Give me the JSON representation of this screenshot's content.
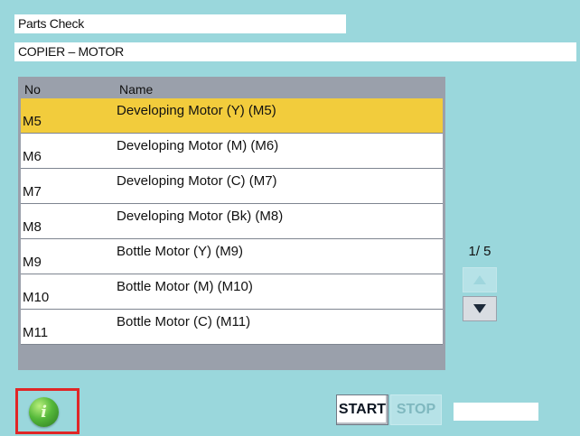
{
  "header": {
    "title": "Parts Check",
    "subtitle": "COPIER – MOTOR"
  },
  "table": {
    "columns": {
      "no": "No",
      "name": "Name"
    },
    "rows": [
      {
        "no": "M5",
        "name": "Developing Motor (Y) (M5)",
        "selected": true
      },
      {
        "no": "M6",
        "name": "Developing Motor (M) (M6)"
      },
      {
        "no": "M7",
        "name": "Developing Motor (C) (M7)"
      },
      {
        "no": "M8",
        "name": "Developing Motor (Bk) (M8)"
      },
      {
        "no": "M9",
        "name": "Bottle Motor (Y) (M9)"
      },
      {
        "no": "M10",
        "name": "Bottle Motor (M) (M10)"
      },
      {
        "no": "M11",
        "name": "Bottle Motor (C) (M11)"
      }
    ]
  },
  "pagination": {
    "indicator": "1/ 5",
    "up_icon": "arrow-up-icon",
    "down_icon": "arrow-down-icon"
  },
  "footer": {
    "info_icon": "info-icon",
    "info_glyph": "i",
    "start_label": "START",
    "stop_label": "STOP",
    "status_text": ""
  },
  "colors": {
    "background": "#9ad7dc",
    "selected_row": "#f2cc3c",
    "highlight_frame": "#e02626"
  }
}
